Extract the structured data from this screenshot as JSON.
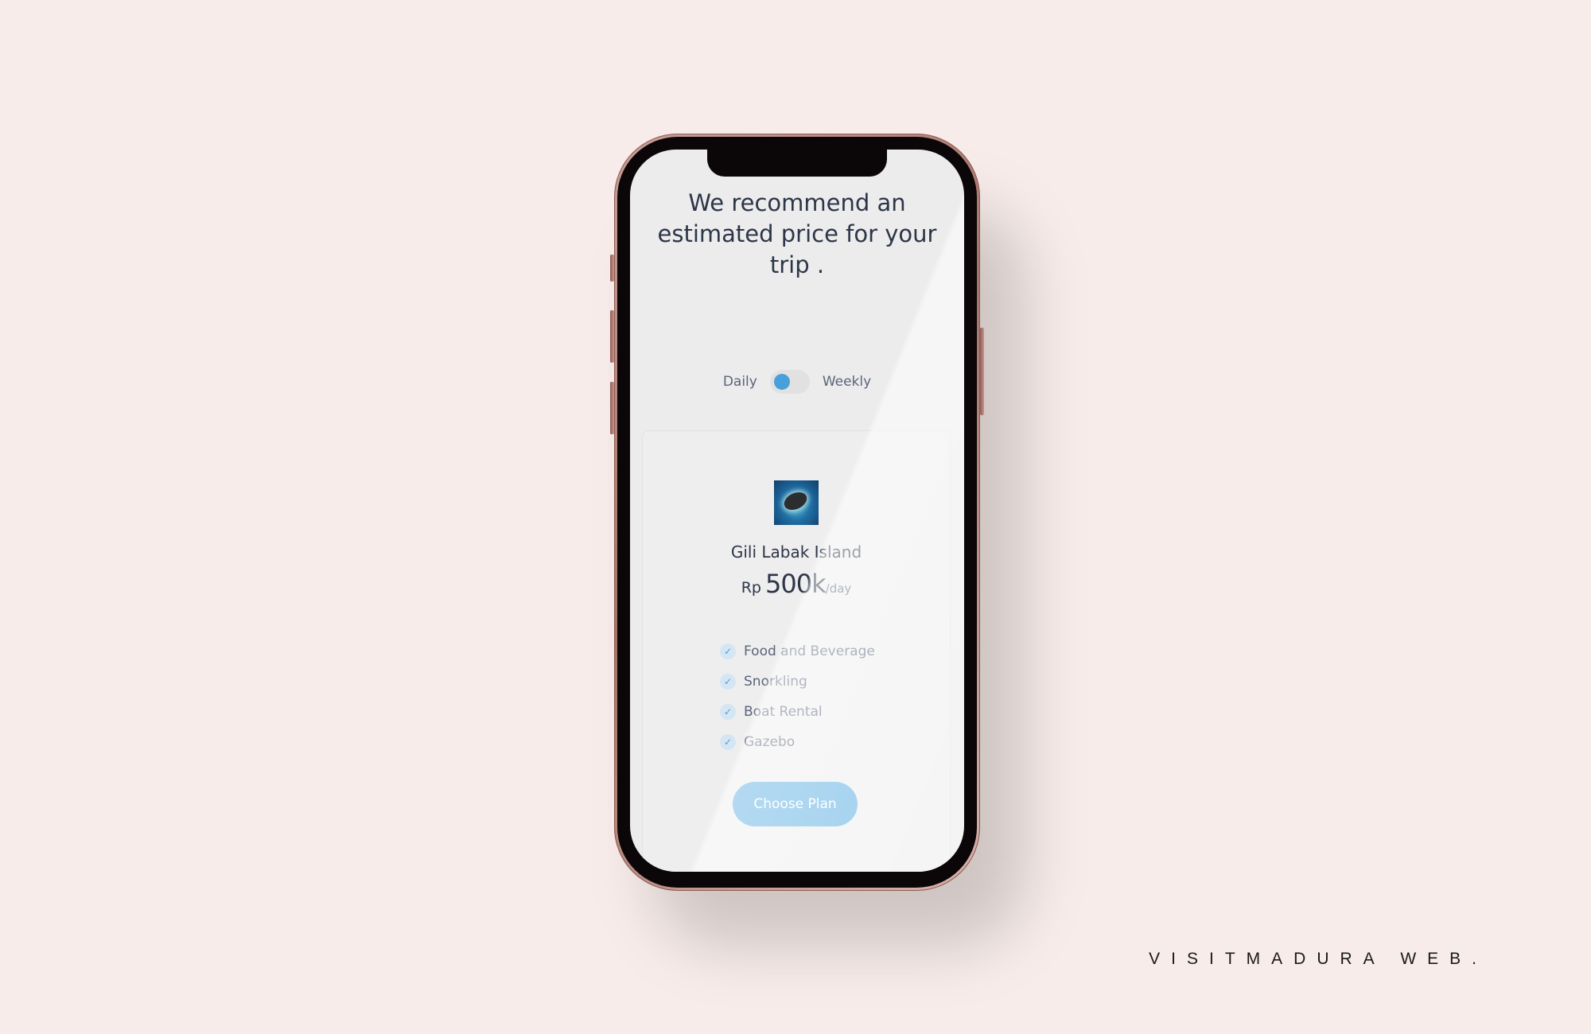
{
  "screen": {
    "headline": "We recommend an estimated price for your trip .",
    "billing_toggle": {
      "left_label": "Daily",
      "right_label": "Weekly",
      "selected": "Daily"
    },
    "plan_card": {
      "image_icon": "island-image",
      "title": "Gili Labak Island",
      "currency": "Rp",
      "price": "500k",
      "period": "/day",
      "features": [
        {
          "icon": "check-icon",
          "label": "Food and Beverage"
        },
        {
          "icon": "check-icon",
          "label": "Snorkling"
        },
        {
          "icon": "check-icon",
          "label": "Boat Rental"
        },
        {
          "icon": "check-icon",
          "label": "Gazebo"
        }
      ],
      "button_label": "Choose Plan"
    }
  },
  "brand_caption": "VISITMADURA WEB.",
  "colors": {
    "background": "#f7ece9",
    "accent": "#5aade2",
    "text": "#2d3548",
    "screen": "#ececec"
  }
}
